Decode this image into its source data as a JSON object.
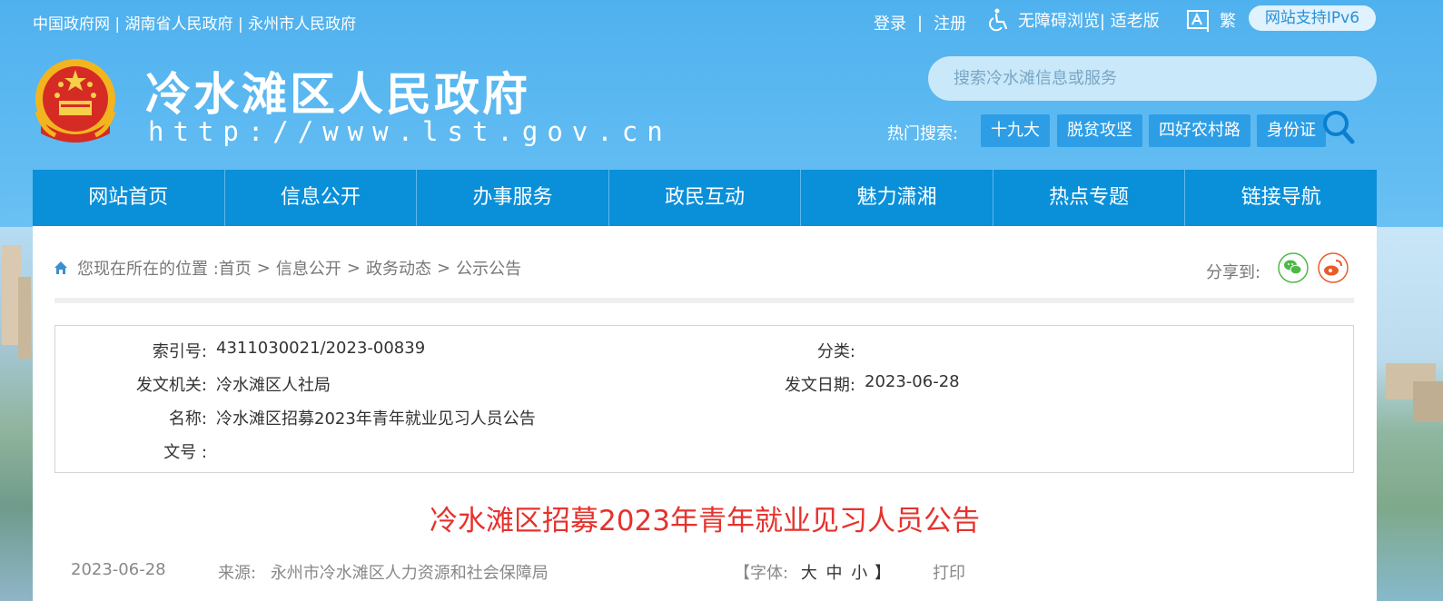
{
  "top_links": {
    "link1": "中国政府网",
    "sep1": " | ",
    "link2": "湖南省人民政府",
    "sep2": " | ",
    "link3": "永州市人民政府"
  },
  "user": {
    "login": "登录",
    "sep": "|",
    "register": "注册"
  },
  "accessibility": {
    "accessible": "无障碍浏览",
    "elderly": "| 适老版"
  },
  "traditional": "繁",
  "ipv6": "网站支持IPv6",
  "site": {
    "name": "冷水滩区人民政府",
    "url": "http://www.lst.gov.cn"
  },
  "search": {
    "placeholder": "搜索冷水滩信息或服务"
  },
  "hot_search": {
    "label": "热门搜索:",
    "items": [
      "十九大",
      "脱贫攻坚",
      "四好农村路",
      "身份证"
    ]
  },
  "nav": [
    "网站首页",
    "信息公开",
    "办事服务",
    "政民互动",
    "魅力潇湘",
    "热点专题",
    "链接导航"
  ],
  "breadcrumb": {
    "prefix": "您现在所在的位置 : ",
    "items": [
      "首页",
      "信息公开",
      "政务动态",
      "公示公告"
    ],
    "sep": ">"
  },
  "share": {
    "label": "分享到:"
  },
  "meta": {
    "index_label": "索引号:",
    "index_value": "4311030021/2023-00839",
    "category_label": "分类:",
    "category_value": "",
    "issuer_label": "发文机关:",
    "issuer_value": "冷水滩区人社局",
    "date_label": "发文日期:",
    "date_value": "2023-06-28",
    "name_label": "名称:",
    "name_value": "冷水滩区招募2023年青年就业见习人员公告",
    "docno_label": "文号 :",
    "docno_value": ""
  },
  "article": {
    "title": "冷水滩区招募2023年青年就业见习人员公告",
    "date": "2023-06-28",
    "source_label": "来源:",
    "source_value": "永州市冷水滩区人力资源和社会保障局",
    "font_open": "【字体:",
    "font_sizes": "大 中 小",
    "font_close": "】",
    "print": "打印"
  },
  "colors": {
    "nav_bg": "#0a8fd9",
    "title_red": "#e5322d",
    "hot_bg": "#2d9ee6"
  }
}
